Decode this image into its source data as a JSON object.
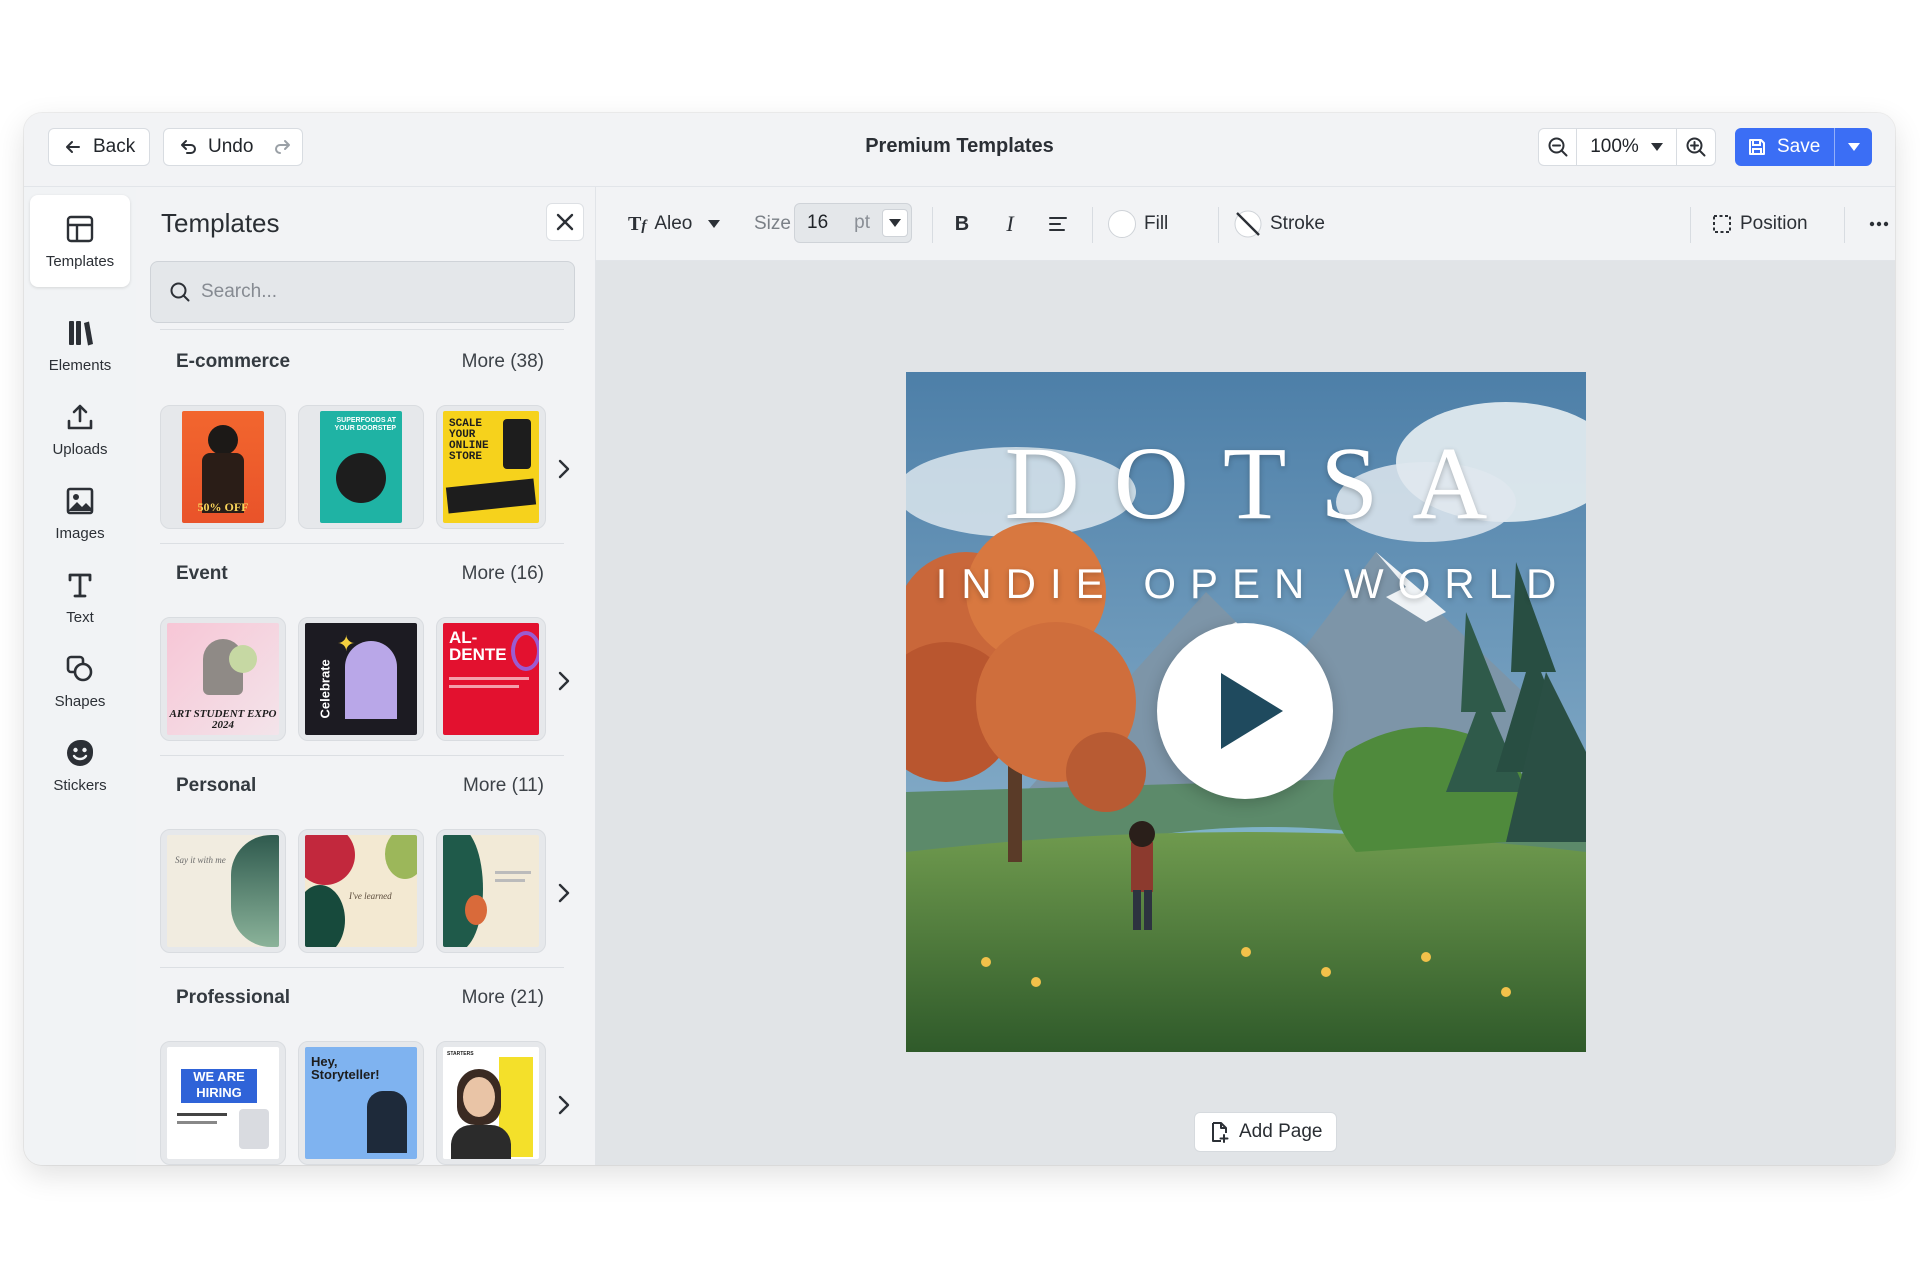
{
  "topbar": {
    "back_label": "Back",
    "undo_label": "Undo",
    "title": "Premium Templates",
    "zoom": "100%",
    "save_label": "Save"
  },
  "rail": {
    "items": [
      {
        "label": "Templates",
        "icon": "layout-icon",
        "active": true
      },
      {
        "label": "Elements",
        "icon": "elements-icon"
      },
      {
        "label": "Uploads",
        "icon": "upload-icon"
      },
      {
        "label": "Images",
        "icon": "image-icon"
      },
      {
        "label": "Text",
        "icon": "text-icon"
      },
      {
        "label": "Shapes",
        "icon": "shapes-icon"
      },
      {
        "label": "Stickers",
        "icon": "sticker-icon"
      }
    ]
  },
  "panel": {
    "title": "Templates",
    "search_placeholder": "Search...",
    "categories": [
      {
        "name": "E-commerce",
        "more": "More (38)",
        "thumb_texts": [
          "50% OFF",
          "SUPERFOODS AT YOUR DOORSTEP",
          "SCALE YOUR ONLINE STORE"
        ]
      },
      {
        "name": "Event",
        "more": "More (16)",
        "thumb_texts": [
          "ART STUDENT EXPO 2024",
          "Celebrate",
          "AL-DENTE"
        ]
      },
      {
        "name": "Personal",
        "more": "More (11)",
        "thumb_texts": [
          "Say it with me",
          "I've learned",
          ""
        ]
      },
      {
        "name": "Professional",
        "more": "More (21)",
        "thumb_texts": [
          "WE ARE HIRING",
          "Hey, Storyteller!",
          "STARTERS"
        ]
      }
    ]
  },
  "toolbar": {
    "font": "Aleo",
    "size_label": "Size",
    "size_value": "16",
    "size_unit": "pt",
    "fill_label": "Fill",
    "stroke_label": "Stroke",
    "position_label": "Position"
  },
  "canvas": {
    "headline": "DOTSA",
    "subline": "INDIE OPEN WORLD"
  },
  "add_page_label": "Add Page",
  "colors": {
    "accent": "#3b6ef5",
    "panel_bg": "#f2f3f5",
    "stage_bg": "#e1e4e7"
  }
}
